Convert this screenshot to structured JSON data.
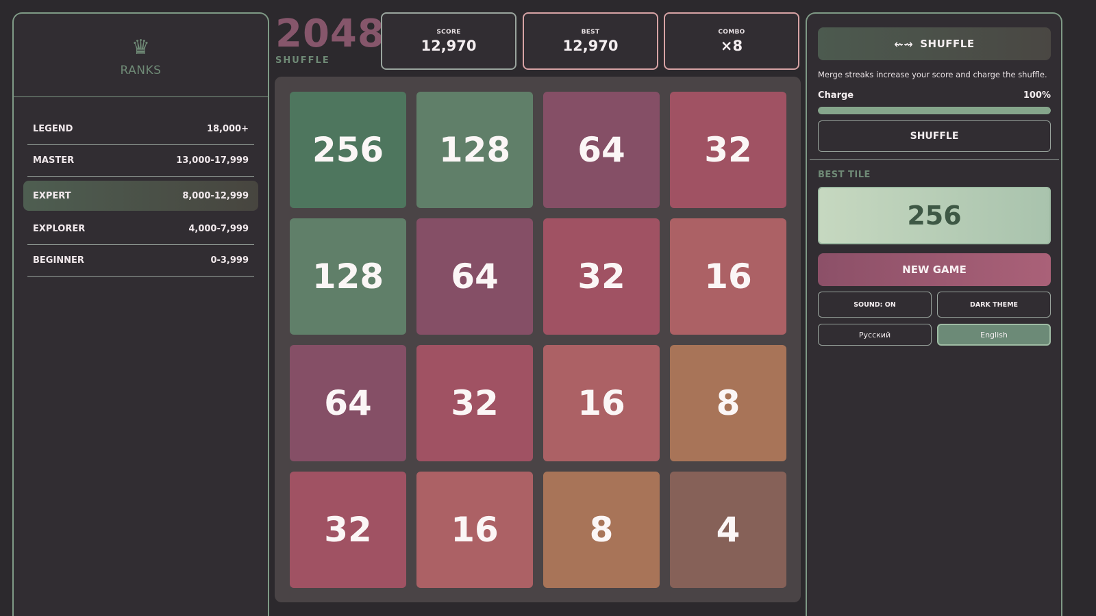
{
  "ranks": {
    "icon": "crown-icon",
    "title": "RANKS",
    "items": [
      {
        "name": "LEGEND",
        "range": "18,000+",
        "active": false
      },
      {
        "name": "MASTER",
        "range": "13,000-17,999",
        "active": false
      },
      {
        "name": "EXPERT",
        "range": "8,000-12,999",
        "active": true
      },
      {
        "name": "EXPLORER",
        "range": "4,000-7,999",
        "active": false
      },
      {
        "name": "BEGINNER",
        "range": "0-3,999",
        "active": false
      }
    ]
  },
  "logo": {
    "main": "2048:",
    "sub": "SHUFFLE"
  },
  "stats": {
    "score_label": "SCORE",
    "score_value": "12,970",
    "best_label": "BEST",
    "best_value": "12,970",
    "combo_label": "COMBO",
    "combo_value": "×8"
  },
  "board": {
    "tiles": [
      [
        "256",
        "128",
        "64",
        "32"
      ],
      [
        "128",
        "64",
        "32",
        "16"
      ],
      [
        "64",
        "32",
        "16",
        "8"
      ],
      [
        "32",
        "16",
        "8",
        "4"
      ]
    ],
    "tile_colors": {
      "256": "#4e765e",
      "128": "#607f69",
      "64": "#854f66",
      "32": "#a05263",
      "16": "#ac6165",
      "8": "#a87458",
      "4": "#866158"
    }
  },
  "sidebar": {
    "shuffle_header": "SHUFFLE",
    "shuffle_icon": "shuffle-arrows-icon",
    "hint": "Merge streaks increase your score and charge the shuffle.",
    "charge_label": "Charge",
    "charge_value": "100%",
    "charge_level": 1.0,
    "shuffle_button": "SHUFFLE",
    "best_tile_label": "BEST TILE",
    "best_tile_value": "256",
    "new_game": "NEW GAME",
    "sound": "SOUND: ON",
    "theme": "DARK THEME",
    "lang_ru": "Русский",
    "lang_en": "English",
    "selected_language": "English"
  }
}
